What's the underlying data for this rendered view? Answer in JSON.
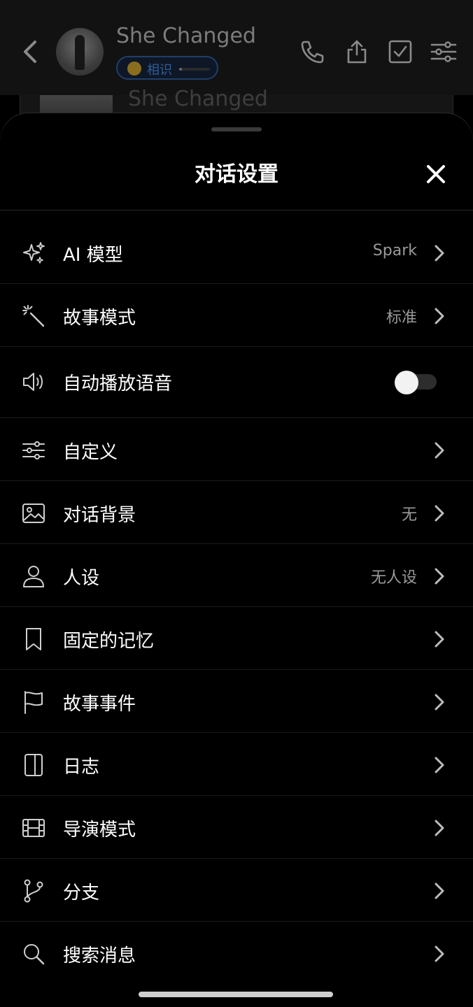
{
  "header": {
    "title": "She Changed",
    "relation_label": "相识",
    "relation_progress": 0.1,
    "icons": [
      "back-icon",
      "phone-icon",
      "share-icon",
      "checkbox-icon",
      "sliders-icon"
    ]
  },
  "background_card": {
    "title": "She Changed"
  },
  "sheet": {
    "title": "对话设置",
    "close_icon": "close-icon",
    "items": [
      {
        "label": "AI 模型",
        "value": "Spark",
        "icon": "sparkles-icon"
      },
      {
        "label": "故事模式",
        "value": "标准",
        "icon": "magic-wand-icon"
      },
      {
        "label": "自动播放语音",
        "value": "",
        "icon": "speaker-icon",
        "toggle": false
      },
      {
        "label": "自定义",
        "value": "",
        "icon": "sliders-icon"
      },
      {
        "label": "对话背景",
        "value": "无",
        "icon": "image-icon"
      },
      {
        "label": "人设",
        "value": "无人设",
        "icon": "person-icon"
      },
      {
        "label": "固定的记忆",
        "value": "",
        "icon": "bookmark-icon"
      },
      {
        "label": "故事事件",
        "value": "",
        "icon": "flag-icon"
      },
      {
        "label": "日志",
        "value": "",
        "icon": "journal-icon"
      },
      {
        "label": "导演模式",
        "value": "",
        "icon": "film-icon"
      },
      {
        "label": "分支",
        "value": "",
        "icon": "branch-icon"
      },
      {
        "label": "搜索消息",
        "value": "",
        "icon": "search-icon"
      }
    ]
  },
  "colors": {
    "background": "#000000",
    "header_bg": "#121212",
    "text_primary": "#ffffff",
    "text_secondary": "#9a9a9a",
    "badge_border": "#1f3f6a",
    "badge_text": "#2f5f99"
  }
}
